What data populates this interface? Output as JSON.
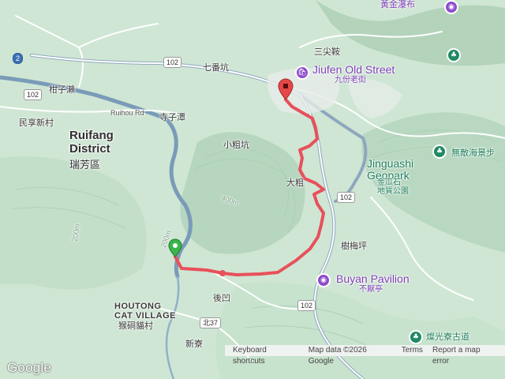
{
  "map": {
    "attribution": {
      "keyboard": "Keyboard shortcuts",
      "data": "Map data ©2026 Google",
      "terms": "Terms",
      "report": "Report a map error"
    },
    "logo": "Google",
    "places": {
      "jiufen_en": "Jiufen Old Street",
      "jiufen_zh": "九份老街",
      "jinguashi_en": "Jinguashi\nGeopark",
      "jinguashi_zh": "金瓜石\n地質公園",
      "buyan_en": "Buyan Pavilion",
      "buyan_zh": "不厭亭",
      "wudi_zh": "無敵海景步",
      "canguang_zh": "燦光寮古道",
      "huangjin_zh": "黃金瀑布",
      "ruifang_en": "Ruifang\nDistrict",
      "ruifang_zh": "瑞芳區",
      "houtong_en": "HOUTONG\nCAT VILLAGE",
      "houtong_zh": "猴硐貓村",
      "sanjianqi": "三尖鞍",
      "qifankeng": "七番坑",
      "ganzilai": "柑子瀨",
      "minxiangxincun": "民享新村",
      "siziwan": "寺子潭",
      "xiaocukeng": "小粗坑",
      "dacu": "大粗",
      "shumeiping": "樹梅坪",
      "houao": "後凹",
      "xinliao": "新寮",
      "ruihou_rd": "Ruihou Rd"
    },
    "shields": {
      "r102_top": "102",
      "r102_left": "102",
      "r102_right": "102",
      "r102_bottom": "102",
      "r2": "2",
      "bei37": "北37"
    },
    "elevation": {
      "e200_left": "200m",
      "e400": "400m",
      "e200_mid": "200m"
    },
    "colors": {
      "route": "#e8505b",
      "terrain": "#cfe6d4",
      "road": "#ffffff",
      "river": "#7a9bb8",
      "poi_purple": "#8e4ccc",
      "park_green": "#1f8a64"
    }
  }
}
